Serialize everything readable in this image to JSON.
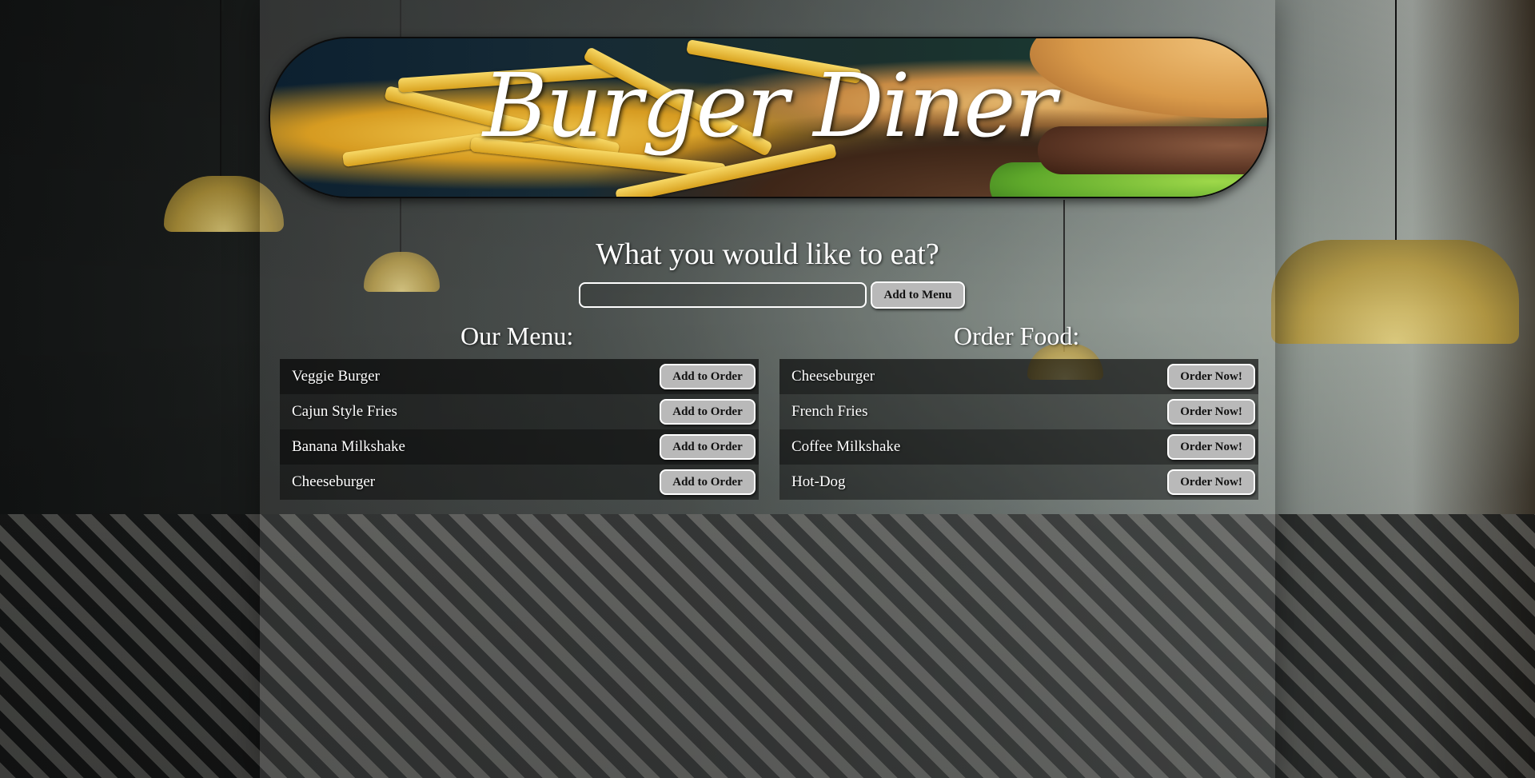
{
  "banner": {
    "title": "Burger Diner"
  },
  "prompt": {
    "question": "What you would like to eat?",
    "input_value": "",
    "input_placeholder": "",
    "add_button_label": "Add to Menu"
  },
  "menu": {
    "heading": "Our Menu:",
    "button_label": "Add to Order",
    "items": [
      {
        "name": "Veggie Burger"
      },
      {
        "name": "Cajun Style Fries"
      },
      {
        "name": "Banana Milkshake"
      },
      {
        "name": "Cheeseburger"
      }
    ]
  },
  "order": {
    "heading": "Order Food:",
    "button_label": "Order Now!",
    "items": [
      {
        "name": "Cheeseburger"
      },
      {
        "name": "French Fries"
      },
      {
        "name": "Coffee Milkshake"
      },
      {
        "name": "Hot-Dog"
      }
    ]
  },
  "colors": {
    "text": "#ffffff",
    "button_bg": "#b9b9b9",
    "button_border": "#ffffff"
  }
}
